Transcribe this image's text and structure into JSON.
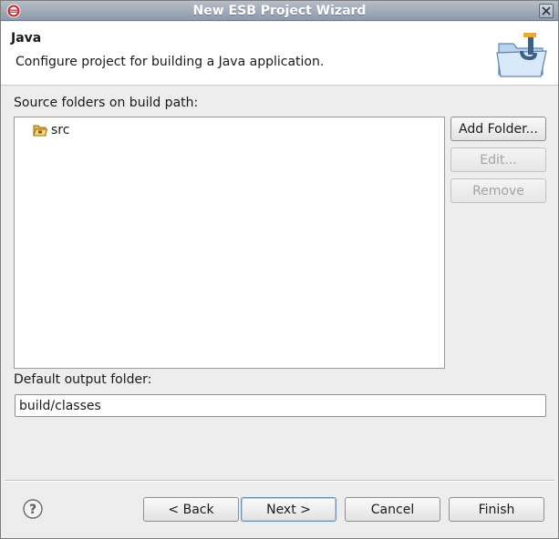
{
  "window": {
    "title": "New ESB Project Wizard",
    "app_icon": "eclipse-icon",
    "close_icon": "close-icon"
  },
  "header": {
    "title": "Java",
    "description": "Configure project for building a Java application.",
    "banner_icon": "java-folder-icon"
  },
  "source_folders": {
    "label": "Source folders on build path:",
    "items": [
      {
        "label": "src",
        "icon": "source-folder-icon"
      }
    ],
    "buttons": {
      "add": "Add Folder...",
      "edit": "Edit...",
      "remove": "Remove"
    }
  },
  "output": {
    "label": "Default output folder:",
    "value": "build/classes"
  },
  "footer": {
    "help_icon": "help-icon",
    "back": "< Back",
    "next": "Next >",
    "cancel": "Cancel",
    "finish": "Finish"
  },
  "colors": {
    "titlebar": "#9aa5b5",
    "window_bg": "#ededed",
    "header_bg": "#ffffff",
    "focus_border": "#6d8fb4"
  }
}
